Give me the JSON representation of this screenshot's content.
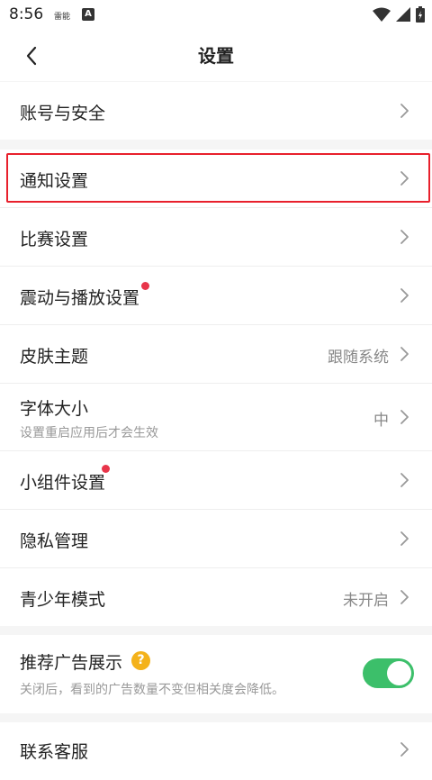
{
  "status_bar": {
    "time": "8:56",
    "carrier": "雷能",
    "app_badge": "A"
  },
  "header": {
    "title": "设置"
  },
  "rows": {
    "account": {
      "label": "账号与安全"
    },
    "notification": {
      "label": "通知设置"
    },
    "match": {
      "label": "比赛设置"
    },
    "vibration": {
      "label": "震动与播放设置"
    },
    "skin": {
      "label": "皮肤主题",
      "value": "跟随系统"
    },
    "font": {
      "label": "字体大小",
      "sub": "设置重启应用后才会生效",
      "value": "中"
    },
    "widget": {
      "label": "小组件设置"
    },
    "privacy": {
      "label": "隐私管理"
    },
    "youth": {
      "label": "青少年模式",
      "value": "未开启"
    },
    "ads": {
      "label": "推荐广告展示",
      "sub": "关闭后，看到的广告数量不变但相关度会降低。",
      "help": "?",
      "toggle_on": true
    },
    "support": {
      "label": "联系客服"
    }
  },
  "colors": {
    "accent_green": "#3cbf6a",
    "badge_red": "#e8354a",
    "highlight_red": "#e8202c",
    "help_yellow": "#f4b21a"
  }
}
